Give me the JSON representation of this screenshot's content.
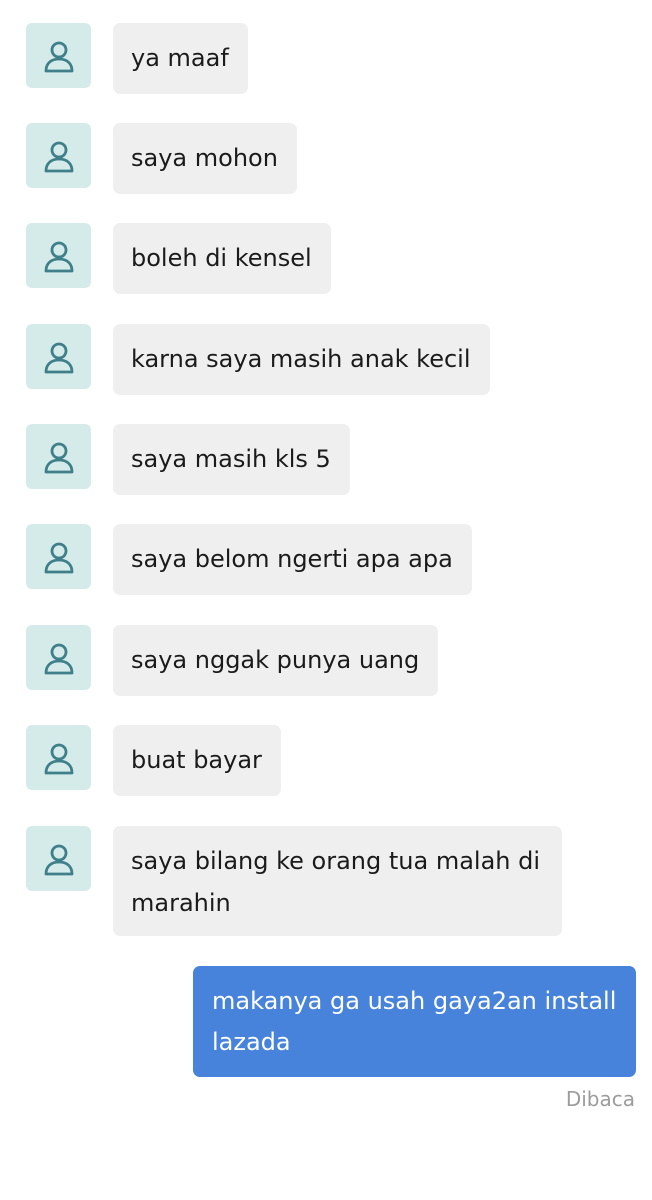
{
  "conversation": {
    "incoming": [
      {
        "text": "ya maaf"
      },
      {
        "text": "saya mohon"
      },
      {
        "text": "boleh di kensel"
      },
      {
        "text": "karna saya masih anak kecil"
      },
      {
        "text": "saya masih kls 5"
      },
      {
        "text": "saya belom ngerti apa apa"
      },
      {
        "text": "saya nggak punya uang"
      },
      {
        "text": "buat bayar"
      },
      {
        "text": "saya bilang ke orang tua malah di marahin"
      }
    ],
    "outgoing": [
      {
        "text": "makanya ga usah gaya2an install lazada"
      }
    ],
    "read_status": "Dibaca"
  },
  "icons": {
    "avatar": "user-outline-icon"
  },
  "colors": {
    "avatar_bg": "#d4ebea",
    "avatar_icon": "#3f7f8a",
    "incoming_bubble": "#efefef",
    "outgoing_bubble": "#4783db",
    "read_status_text": "#9c9c9c"
  }
}
